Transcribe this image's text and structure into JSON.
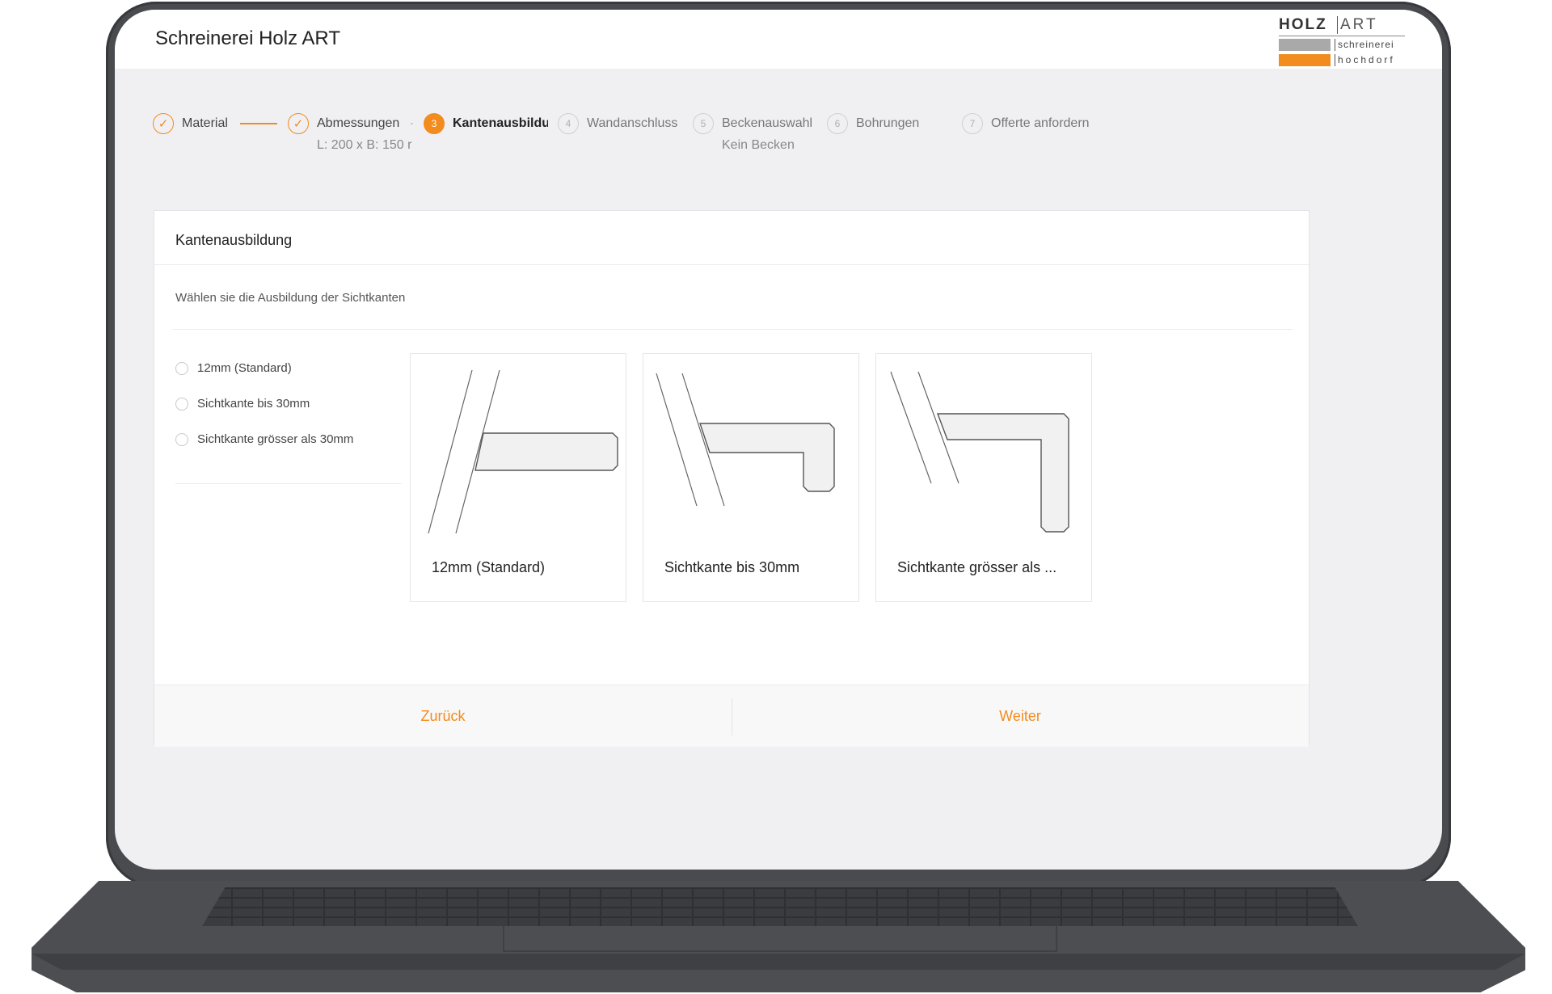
{
  "app": {
    "title": "Schreinerei Holz ART"
  },
  "logo": {
    "holz": "HOLZ",
    "art": "ART",
    "line1": "schreinerei",
    "line2": "hochdorf",
    "colors": {
      "grey": "#a9a9a9",
      "orange": "#f28c1e"
    }
  },
  "stepper": {
    "steps": [
      {
        "number": "✓",
        "label": "Material",
        "status": "done",
        "sub": ""
      },
      {
        "number": "✓",
        "label": "Abmessungen",
        "status": "done",
        "sub": "L: 200 x B: 150 r"
      },
      {
        "number": "3",
        "label": "Kantenausbildu",
        "status": "active",
        "sub": ""
      },
      {
        "number": "4",
        "label": "Wandanschluss",
        "status": "pending",
        "sub": ""
      },
      {
        "number": "5",
        "label": "Beckenauswahl",
        "status": "pending",
        "sub": "Kein Becken"
      },
      {
        "number": "6",
        "label": "Bohrungen",
        "status": "pending",
        "sub": ""
      },
      {
        "number": "7",
        "label": "Offerte anfordern",
        "status": "pending",
        "sub": ""
      }
    ]
  },
  "card": {
    "title": "Kantenausbildung",
    "subtitle": "Wählen sie die Ausbildung der Sichtkanten",
    "radio_options": [
      {
        "label": "12mm (Standard)",
        "selected": false
      },
      {
        "label": "Sichtkante bis 30mm",
        "selected": false
      },
      {
        "label": "Sichtkante grösser als 30mm",
        "selected": false
      }
    ],
    "option_cards": [
      {
        "label": "12mm (Standard)",
        "illustration": "edge-12mm-icon"
      },
      {
        "label": "Sichtkante bis 30mm",
        "illustration": "edge-30mm-icon"
      },
      {
        "label": "Sichtkante grösser als ...",
        "illustration": "edge-large-icon"
      }
    ],
    "footer": {
      "back_label": "Zurück",
      "next_label": "Weiter"
    }
  },
  "colors": {
    "accent": "#f28c1e",
    "screen_bg": "#f0f0f3",
    "frame": "#4a4b4f"
  }
}
